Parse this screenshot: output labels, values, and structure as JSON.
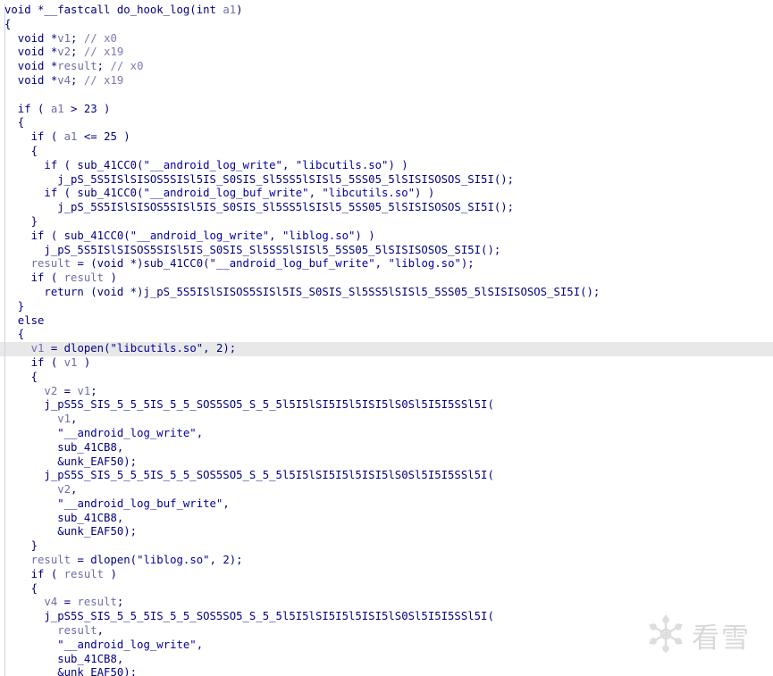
{
  "editor": {
    "highlighted_line": 24,
    "lines": [
      "void *__fastcall do_hook_log(int a1)",
      "{",
      "  void *v1; // x0",
      "  void *v2; // x19",
      "  void *result; // x0",
      "  void *v4; // x19",
      "",
      "  if ( a1 > 23 )",
      "  {",
      "    if ( a1 <= 25 )",
      "    {",
      "      if ( sub_41CC0(\"__android_log_write\", \"libcutils.so\") )",
      "        j_pS_5S5ISlSISOS5SISl5IS_S0SIS_Sl5SS5lSISl5_5SS05_5lSISISOSOS_SI5I();",
      "      if ( sub_41CC0(\"__android_log_buf_write\", \"libcutils.so\") )",
      "        j_pS_5S5ISlSISOS5SISl5IS_S0SIS_Sl5SS5lSISl5_5SS05_5lSISISOSOS_SI5I();",
      "    }",
      "    if ( sub_41CC0(\"__android_log_write\", \"liblog.so\") )",
      "      j_pS_5S5ISlSISOS5SISl5IS_S0SIS_Sl5SS5lSISl5_5SS05_5lSISISOSOS_SI5I();",
      "    result = (void *)sub_41CC0(\"__android_log_buf_write\", \"liblog.so\");",
      "    if ( result )",
      "      return (void *)j_pS_5S5ISlSISOS5SISl5IS_S0SIS_Sl5SS5lSISl5_5SS05_5lSISISOSOS_SI5I();",
      "  }",
      "  else",
      "  {",
      "    v1 = dlopen(\"libcutils.so\", 2);",
      "    if ( v1 )",
      "    {",
      "      v2 = v1;",
      "      j_pS5S_SIS_5_5_5IS_5_5_SOS5SO5_S_5_5l5I5lSI5I5l5ISI5lS0Sl5I5I5SSl5I(",
      "        v1,",
      "        \"__android_log_write\",",
      "        sub_41CB8,",
      "        &unk_EAF50);",
      "      j_pS5S_SIS_5_5_5IS_5_5_SOS5SO5_S_5_5l5I5lSI5I5l5ISI5lS0Sl5I5I5SSl5I(",
      "        v2,",
      "        \"__android_log_buf_write\",",
      "        sub_41CB8,",
      "        &unk_EAF50);",
      "    }",
      "    result = dlopen(\"liblog.so\", 2);",
      "    if ( result )",
      "    {",
      "      v4 = result;",
      "      j_pS5S_SIS_5_5_5IS_5_5_SOS5SO5_S_5_5l5I5lSI5I5l5ISI5lS0Sl5I5I5SSl5I(",
      "        result,",
      "        \"__android_log_write\",",
      "        sub_41CB8,",
      "        &unk_EAF50);"
    ]
  },
  "watermark": {
    "text": "看雪",
    "icon": "snowflake-icon"
  }
}
